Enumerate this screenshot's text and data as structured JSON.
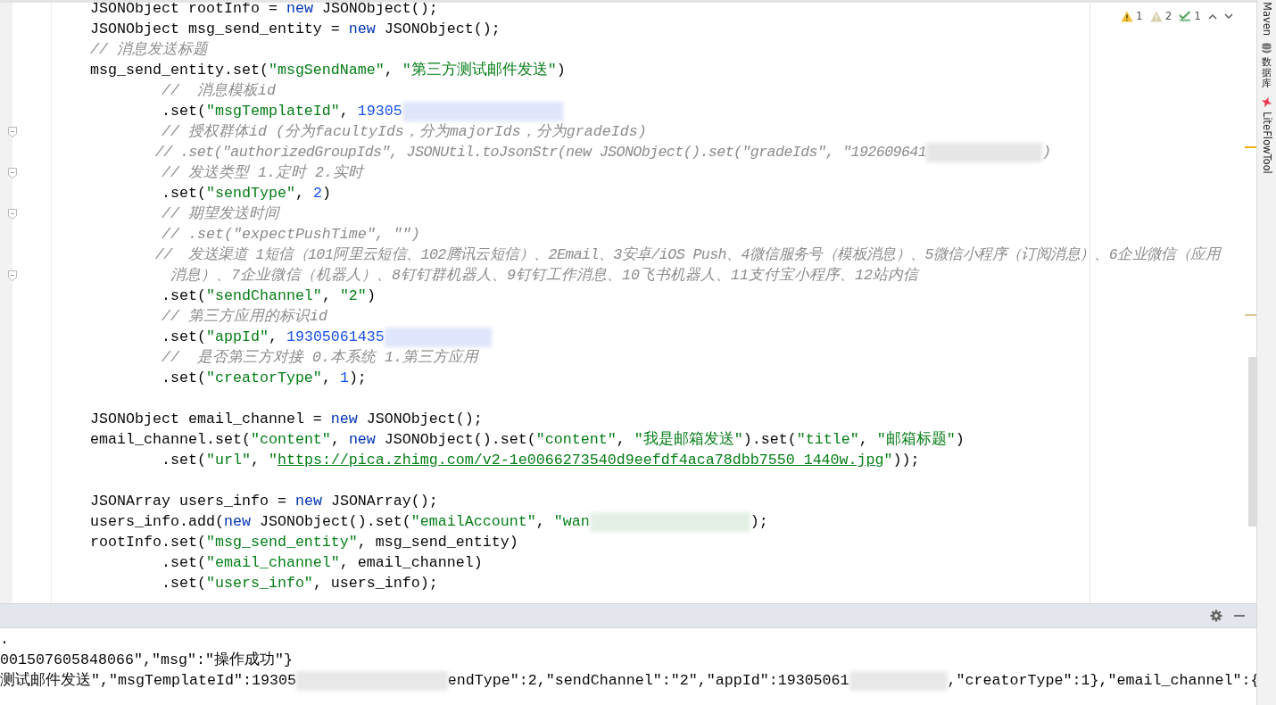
{
  "editor": {
    "lines": [
      {
        "fold": false,
        "tokens": [
          {
            "kind": "plain",
            "text": "    JSONObject rootInfo = "
          },
          {
            "kind": "keyword",
            "text": "new"
          },
          {
            "kind": "plain",
            "text": " JSONObject();"
          }
        ]
      },
      {
        "fold": false,
        "tokens": [
          {
            "kind": "plain",
            "text": "    JSONObject msg_send_entity = "
          },
          {
            "kind": "keyword",
            "text": "new"
          },
          {
            "kind": "plain",
            "text": " JSONObject();"
          }
        ]
      },
      {
        "fold": false,
        "tokens": [
          {
            "kind": "comment",
            "text": "    // 消息发送标题"
          }
        ]
      },
      {
        "fold": false,
        "tokens": [
          {
            "kind": "plain",
            "text": "    msg_send_entity.set("
          },
          {
            "kind": "string",
            "text": "\"msgSendName\""
          },
          {
            "kind": "plain",
            "text": ", "
          },
          {
            "kind": "string",
            "text": "\"第三方测试邮件发送\""
          },
          {
            "kind": "plain",
            "text": ")"
          }
        ]
      },
      {
        "fold": false,
        "tokens": [
          {
            "kind": "comment",
            "text": "            //  消息模板id"
          }
        ]
      },
      {
        "fold": false,
        "tokens": [
          {
            "kind": "plain",
            "text": "            .set("
          },
          {
            "kind": "string",
            "text": "\"msgTemplateId\""
          },
          {
            "kind": "plain",
            "text": ", "
          },
          {
            "kind": "number",
            "text": "19305"
          },
          {
            "kind": "redacted"
          }
        ]
      },
      {
        "fold": true,
        "tokens": [
          {
            "kind": "comment",
            "text": "            // 授权群体id (分为facultyIds，分为majorIds，分为gradeIds)"
          }
        ]
      },
      {
        "fold": false,
        "tokens": [
          {
            "kind": "comment",
            "text": "            // .set(\"authorizedGroupIds\", JSONUtil.toJsonStr(new JSONObject().set(\"gradeIds\", \"192609641"
          },
          {
            "kind": "redacted"
          },
          {
            "kind": "comment",
            "text": ")"
          }
        ]
      },
      {
        "fold": true,
        "tokens": [
          {
            "kind": "comment",
            "text": "            // 发送类型 1.定时 2.实时"
          }
        ]
      },
      {
        "fold": false,
        "tokens": [
          {
            "kind": "plain",
            "text": "            .set("
          },
          {
            "kind": "string",
            "text": "\"sendType\""
          },
          {
            "kind": "plain",
            "text": ", "
          },
          {
            "kind": "number",
            "text": "2"
          },
          {
            "kind": "plain",
            "text": ")"
          }
        ]
      },
      {
        "fold": true,
        "tokens": [
          {
            "kind": "comment",
            "text": "            // 期望发送时间"
          }
        ]
      },
      {
        "fold": false,
        "tokens": [
          {
            "kind": "comment",
            "text": "            // .set(\"expectPushTime\", \"\")"
          }
        ]
      },
      {
        "fold": false,
        "tokens": [
          {
            "kind": "comment",
            "text": "            //  发送渠道 1短信（101阿里云短信、102腾讯云短信）、2Email、3安卓/iOS Push、4微信服务号（模板消息）、5微信小程序（订阅消息）、6企业微信（应用"
          }
        ]
      },
      {
        "fold": true,
        "tokens": [
          {
            "kind": "comment",
            "text": "             消息）、7企业微信（机器人）、8钉钉群机器人、9钉钉工作消息、10飞书机器人、11支付宝小程序、12站内信"
          }
        ]
      },
      {
        "fold": false,
        "tokens": [
          {
            "kind": "plain",
            "text": "            .set("
          },
          {
            "kind": "string",
            "text": "\"sendChannel\""
          },
          {
            "kind": "plain",
            "text": ", "
          },
          {
            "kind": "string",
            "text": "\"2\""
          },
          {
            "kind": "plain",
            "text": ")"
          }
        ]
      },
      {
        "fold": false,
        "tokens": [
          {
            "kind": "comment",
            "text": "            // 第三方应用的标识id"
          }
        ]
      },
      {
        "fold": false,
        "tokens": [
          {
            "kind": "plain",
            "text": "            .set("
          },
          {
            "kind": "string",
            "text": "\"appId\""
          },
          {
            "kind": "plain",
            "text": ", "
          },
          {
            "kind": "number",
            "text": "19305061435"
          },
          {
            "kind": "redacted"
          }
        ]
      },
      {
        "fold": false,
        "tokens": [
          {
            "kind": "comment",
            "text": "            //  是否第三方对接 0.本系统 1.第三方应用"
          }
        ]
      },
      {
        "fold": false,
        "tokens": [
          {
            "kind": "plain",
            "text": "            .set("
          },
          {
            "kind": "string",
            "text": "\"creatorType\""
          },
          {
            "kind": "plain",
            "text": ", "
          },
          {
            "kind": "number",
            "text": "1"
          },
          {
            "kind": "plain",
            "text": ");"
          }
        ]
      },
      {
        "fold": false
      },
      {
        "fold": false,
        "tokens": [
          {
            "kind": "plain",
            "text": "    JSONObject email_channel = "
          },
          {
            "kind": "keyword",
            "text": "new"
          },
          {
            "kind": "plain",
            "text": " JSONObject();"
          }
        ]
      },
      {
        "fold": false,
        "tokens": [
          {
            "kind": "plain",
            "text": "    email_channel.set("
          },
          {
            "kind": "string",
            "text": "\"content\""
          },
          {
            "kind": "plain",
            "text": ", "
          },
          {
            "kind": "keyword",
            "text": "new"
          },
          {
            "kind": "plain",
            "text": " JSONObject().set("
          },
          {
            "kind": "string",
            "text": "\"content\""
          },
          {
            "kind": "plain",
            "text": ", "
          },
          {
            "kind": "string",
            "text": "\"我是邮箱发送\""
          },
          {
            "kind": "plain",
            "text": ").set("
          },
          {
            "kind": "string",
            "text": "\"title\""
          },
          {
            "kind": "plain",
            "text": ", "
          },
          {
            "kind": "string",
            "text": "\"邮箱标题\""
          },
          {
            "kind": "plain",
            "text": ")"
          }
        ]
      },
      {
        "fold": false,
        "tokens": [
          {
            "kind": "plain",
            "text": "            .set("
          },
          {
            "kind": "string",
            "text": "\"url\""
          },
          {
            "kind": "plain",
            "text": ", "
          },
          {
            "kind": "string",
            "text": "\""
          },
          {
            "kind": "link",
            "text": "https://pica.zhimg.com/v2-1e0066273540d9eefdf4aca78dbb7550_1440w.jpg"
          },
          {
            "kind": "string",
            "text": "\""
          },
          {
            "kind": "plain",
            "text": "));"
          }
        ]
      },
      {
        "fold": false
      },
      {
        "fold": false,
        "tokens": [
          {
            "kind": "plain",
            "text": "    JSONArray users_info = "
          },
          {
            "kind": "keyword",
            "text": "new"
          },
          {
            "kind": "plain",
            "text": " JSONArray();"
          }
        ]
      },
      {
        "fold": false,
        "tokens": [
          {
            "kind": "plain",
            "text": "    users_info.add("
          },
          {
            "kind": "keyword",
            "text": "new"
          },
          {
            "kind": "plain",
            "text": " JSONObject().set("
          },
          {
            "kind": "string",
            "text": "\"emailAccount\""
          },
          {
            "kind": "plain",
            "text": ", "
          },
          {
            "kind": "string",
            "text": "\"wan"
          },
          {
            "kind": "redacted"
          },
          {
            "kind": "plain",
            "text": ");"
          }
        ]
      },
      {
        "fold": false,
        "tokens": [
          {
            "kind": "plain",
            "text": "    rootInfo.set("
          },
          {
            "kind": "string",
            "text": "\"msg_send_entity\""
          },
          {
            "kind": "plain",
            "text": ", msg_send_entity)"
          }
        ]
      },
      {
        "fold": false,
        "tokens": [
          {
            "kind": "plain",
            "text": "            .set("
          },
          {
            "kind": "string",
            "text": "\"email_channel\""
          },
          {
            "kind": "plain",
            "text": ", email_channel)"
          }
        ]
      },
      {
        "fold": false,
        "tokens": [
          {
            "kind": "plain",
            "text": "            .set("
          },
          {
            "kind": "string",
            "text": "\"users_info\""
          },
          {
            "kind": "plain",
            "text": ", users_info);"
          }
        ]
      }
    ]
  },
  "inspections": [
    {
      "kind": "warning",
      "count": "1"
    },
    {
      "kind": "weak_warning",
      "count": "2"
    },
    {
      "kind": "typo",
      "count": "1"
    }
  ],
  "tool_strip": [
    {
      "kind": "text",
      "label": "Maven"
    },
    {
      "kind": "database",
      "label": "数据库"
    },
    {
      "kind": "liteflow",
      "label": "LiteFlowTool"
    }
  ],
  "console": {
    "lines": [
      {
        "tokens": [
          {
            "kind": "plain",
            "text": "."
          }
        ]
      },
      {
        "tokens": [
          {
            "kind": "plain",
            "text": "001507605848066\",\"msg\":\"操作成功\"}"
          }
        ]
      },
      {
        "tokens": [
          {
            "kind": "plain",
            "text": "测试邮件发送\",\"msgTemplateId\":19305"
          },
          {
            "kind": "redacted"
          },
          {
            "kind": "plain",
            "text": "endType\":2,\"sendChannel\":\"2\",\"appId\":19305061"
          },
          {
            "kind": "redacted"
          },
          {
            "kind": "plain",
            "text": ",\"creatorType\":1},\"email_channel\":{"
          }
        ]
      }
    ]
  }
}
